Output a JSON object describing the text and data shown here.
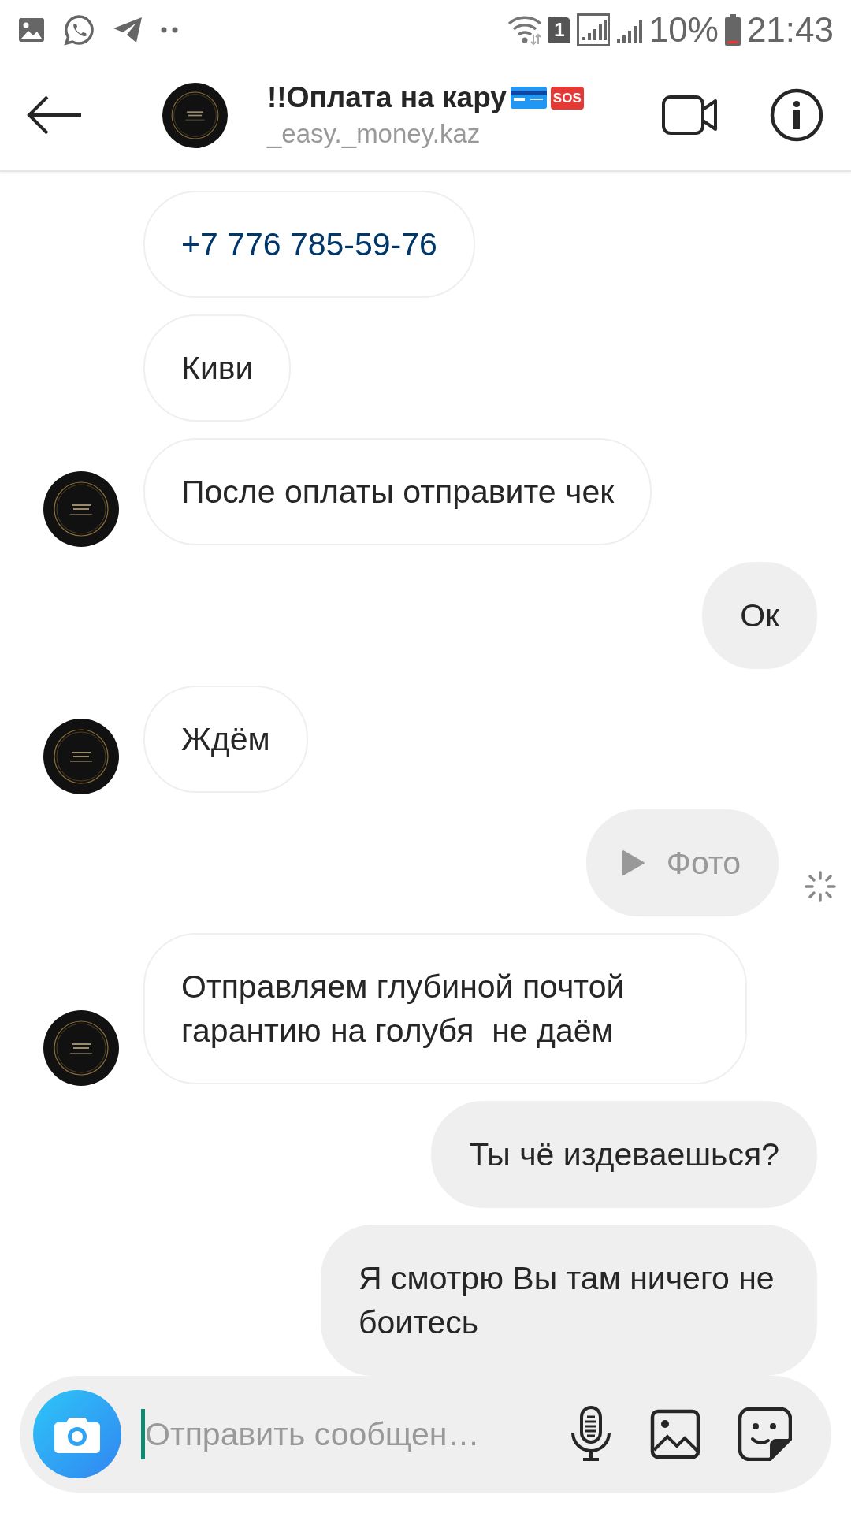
{
  "status_bar": {
    "sim_slot": "1",
    "battery": "10%",
    "time": "21:43"
  },
  "header": {
    "title": "!!Оплата на кару",
    "title_badge": "SOS",
    "username": "_easy._money.kaz"
  },
  "messages": [
    {
      "kind": "link",
      "outgoing": false,
      "avatar": false,
      "text": "+7 776 785-59-76"
    },
    {
      "kind": "text",
      "outgoing": false,
      "avatar": false,
      "text": "Киви"
    },
    {
      "kind": "text",
      "outgoing": false,
      "avatar": true,
      "text": "После оплаты отправите чек"
    },
    {
      "kind": "text",
      "outgoing": true,
      "avatar": false,
      "text": "Ок"
    },
    {
      "kind": "text",
      "outgoing": false,
      "avatar": true,
      "text": "Ждём"
    },
    {
      "kind": "media",
      "outgoing": true,
      "avatar": false,
      "pending": true,
      "text": "Фото"
    },
    {
      "kind": "text",
      "outgoing": false,
      "avatar": true,
      "text": "Отправляем глубиной почтой гарантию на голубя  не даём"
    },
    {
      "kind": "text",
      "outgoing": true,
      "avatar": false,
      "text": "Ты чё издеваешься?"
    },
    {
      "kind": "text",
      "outgoing": true,
      "avatar": false,
      "text": "Я смотрю Вы там ничего не боитесь"
    }
  ],
  "composer": {
    "placeholder": "Отправить сообщен…"
  }
}
